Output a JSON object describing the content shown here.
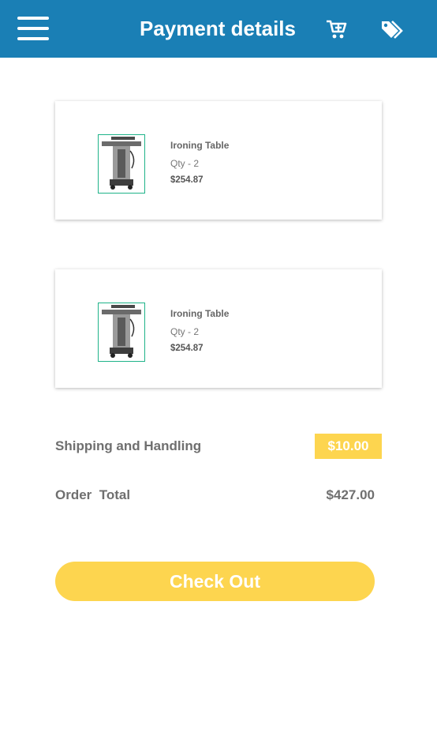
{
  "appbar": {
    "title": "Payment details",
    "color": "#1a7fb5",
    "icons": [
      "menu-icon",
      "add-to-cart-icon",
      "tags-icon"
    ]
  },
  "cart_items": [
    {
      "name": "Ironing Table",
      "qty": "Qty  - 2",
      "price": "$254.87",
      "image": "ironing-table-image"
    },
    {
      "name": "Ironing Table",
      "qty": "Qty  - 2",
      "price": "$254.87",
      "image": "ironing-table-image"
    }
  ],
  "summary": {
    "shipping_label": "Shipping and Handling",
    "shipping_value": "$10.00",
    "total_label": "Order  Total",
    "total_value": "$427.00"
  },
  "checkout": {
    "label": "Check Out",
    "color": "#fdd54f"
  }
}
